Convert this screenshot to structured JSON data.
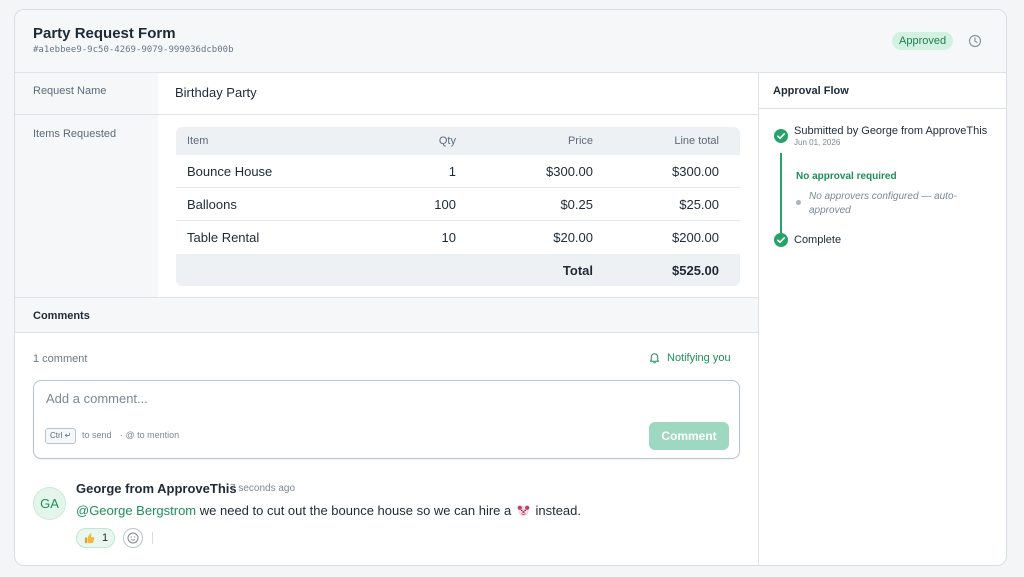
{
  "header": {
    "title": "Party Request Form",
    "uuid": "#a1ebbee9-9c50-4269-9079-999036dcb00b",
    "status": "Approved"
  },
  "fields": {
    "request_name_label": "Request Name",
    "request_name_value": "Birthday Party",
    "items_label": "Items Requested"
  },
  "items_table": {
    "headers": {
      "item": "Item",
      "qty": "Qty",
      "price": "Price",
      "line_total": "Line total"
    },
    "rows": [
      {
        "item": "Bounce House",
        "qty": "1",
        "price": "$300.00",
        "line_total": "$300.00"
      },
      {
        "item": "Balloons",
        "qty": "100",
        "price": "$0.25",
        "line_total": "$25.00"
      },
      {
        "item": "Table Rental",
        "qty": "10",
        "price": "$20.00",
        "line_total": "$200.00"
      }
    ],
    "total_label": "Total",
    "total_value": "$525.00"
  },
  "comments": {
    "section_title": "Comments",
    "count": "1 comment",
    "notify_label": "Notifying you",
    "input_placeholder": "Add a comment...",
    "kbd_hint": "Ctrl ↵",
    "send_hint": "to send",
    "mention_hint": "· @ to mention",
    "submit_label": "Comment",
    "items": [
      {
        "initials": "GA",
        "author": "George from ApproveThis",
        "time": "7 seconds ago",
        "mention": "@George Bergstrom",
        "text_before": " we need to cut out the bounce house so we can hire a ",
        "text_after": " instead.",
        "reaction_count": "1"
      }
    ]
  },
  "approval_flow": {
    "title": "Approval Flow",
    "steps": [
      {
        "title": "Submitted by George from ApproveThis",
        "date": "Jun 01, 2026"
      },
      {
        "title": "Complete"
      }
    ],
    "no_approval": "No approval required",
    "no_approvers": "No approvers configured — auto-approved"
  },
  "colors": {
    "accent": "#1e8f5a",
    "badge_bg": "#d2f1e1",
    "button_disabled": "#9fd8c0"
  },
  "icons": [
    "history-icon",
    "bell-icon",
    "check-circle-icon",
    "thumbs-up-icon",
    "smiley-icon",
    "clown-emoji-icon"
  ]
}
